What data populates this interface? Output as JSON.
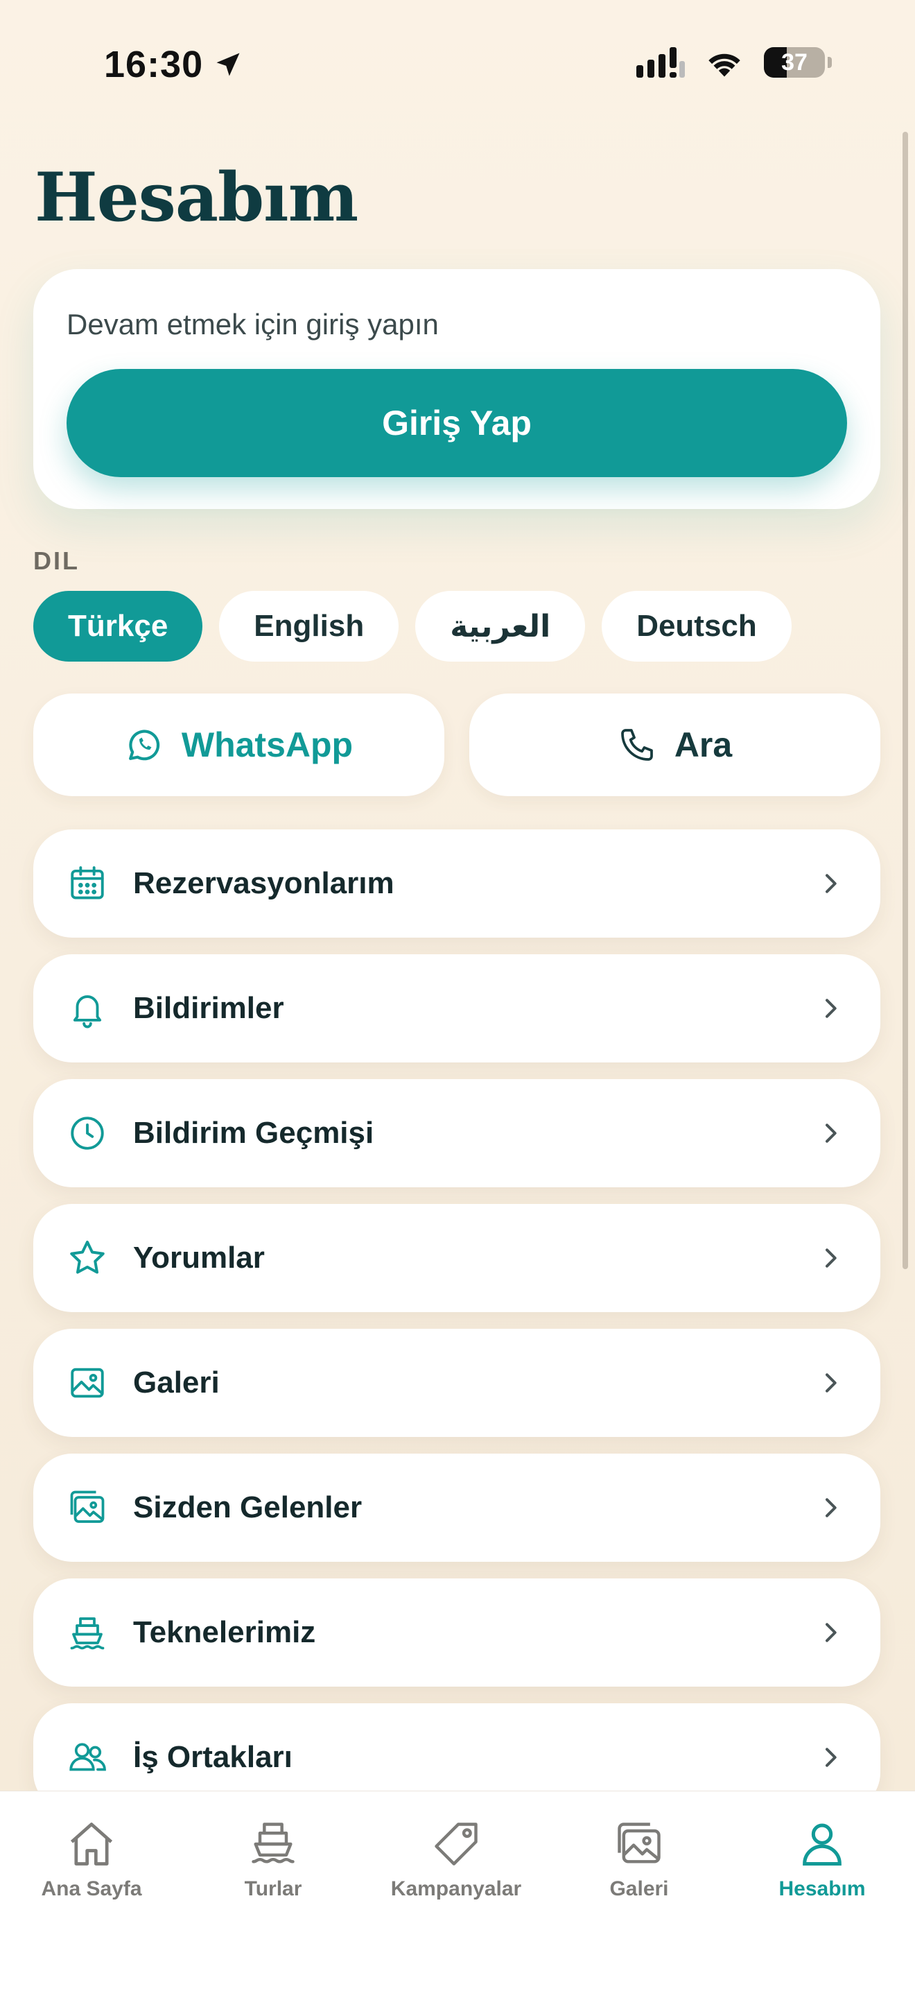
{
  "status_bar": {
    "time": "16:30",
    "battery": "37"
  },
  "page": {
    "title": "Hesabım"
  },
  "login": {
    "prompt": "Devam etmek için giriş yapın",
    "button_label": "Giriş Yap"
  },
  "language": {
    "label": "DIL",
    "options": [
      "Türkçe",
      "English",
      "العربية",
      "Deutsch"
    ],
    "selected": "Türkçe"
  },
  "contact": {
    "whatsapp_label": "WhatsApp",
    "call_label": "Ara"
  },
  "menu": {
    "items": [
      {
        "label": "Rezervasyonlarım",
        "icon": "calendar-icon"
      },
      {
        "label": "Bildirimler",
        "icon": "bell-icon"
      },
      {
        "label": "Bildirim Geçmişi",
        "icon": "clock-icon"
      },
      {
        "label": "Yorumlar",
        "icon": "star-icon"
      },
      {
        "label": "Galeri",
        "icon": "image-icon"
      },
      {
        "label": "Sizden Gelenler",
        "icon": "images-icon"
      },
      {
        "label": "Teknelerimiz",
        "icon": "boat-icon"
      },
      {
        "label": "İş Ortakları",
        "icon": "users-icon"
      }
    ]
  },
  "tabs": {
    "items": [
      {
        "label": "Ana Sayfa",
        "icon": "home-icon"
      },
      {
        "label": "Turlar",
        "icon": "boat-icon"
      },
      {
        "label": "Kampanyalar",
        "icon": "tag-icon"
      },
      {
        "label": "Galeri",
        "icon": "gallery-icon"
      },
      {
        "label": "Hesabım",
        "icon": "user-icon"
      }
    ],
    "active": "Hesabım"
  },
  "colors": {
    "accent": "#119a97",
    "background": "#fbf2e5",
    "title": "#0f3b41"
  }
}
